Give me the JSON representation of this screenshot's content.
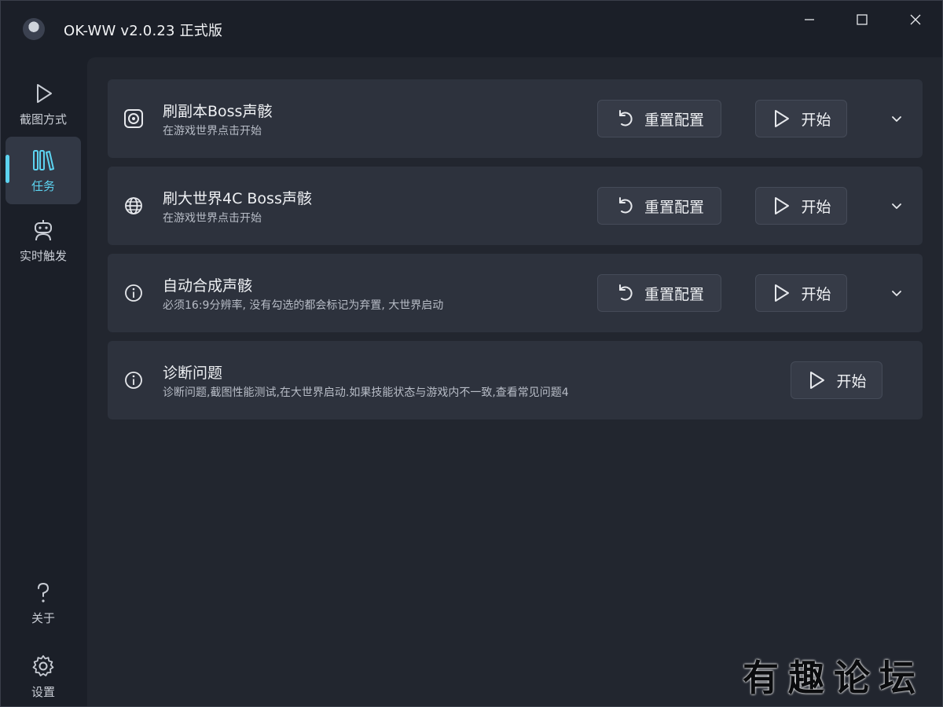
{
  "window": {
    "title": "OK-WW v2.0.23 正式版"
  },
  "sidebar": {
    "items": [
      {
        "label": "截图方式",
        "icon": "play-icon"
      },
      {
        "label": "任务",
        "icon": "library-icon",
        "active": true
      },
      {
        "label": "实时触发",
        "icon": "robot-icon"
      },
      {
        "label": "关于",
        "icon": "question-icon"
      },
      {
        "label": "设置",
        "icon": "gear-icon"
      }
    ]
  },
  "tasks": [
    {
      "title": "刷副本Boss声骸",
      "subtitle": "在游戏世界点击开始",
      "icon": "target-icon",
      "reset_label": "重置配置",
      "start_label": "开始"
    },
    {
      "title": "刷大世界4C Boss声骸",
      "subtitle": "在游戏世界点击开始",
      "icon": "globe-icon",
      "reset_label": "重置配置",
      "start_label": "开始"
    },
    {
      "title": "自动合成声骸",
      "subtitle": "必须16:9分辨率, 没有勾选的都会标记为弃置, 大世界启动",
      "icon": "info-icon",
      "reset_label": "重置配置",
      "start_label": "开始"
    },
    {
      "title": "诊断问题",
      "subtitle": "诊断问题,截图性能测试,在大世界启动.如果技能状态与游戏内不一致,查看常见问题4",
      "icon": "info-icon",
      "start_label": "开始"
    }
  ],
  "colors": {
    "accent": "#5cd3f0",
    "card": "#2d323d",
    "background": "#22262f"
  },
  "watermark": "有趣论坛"
}
